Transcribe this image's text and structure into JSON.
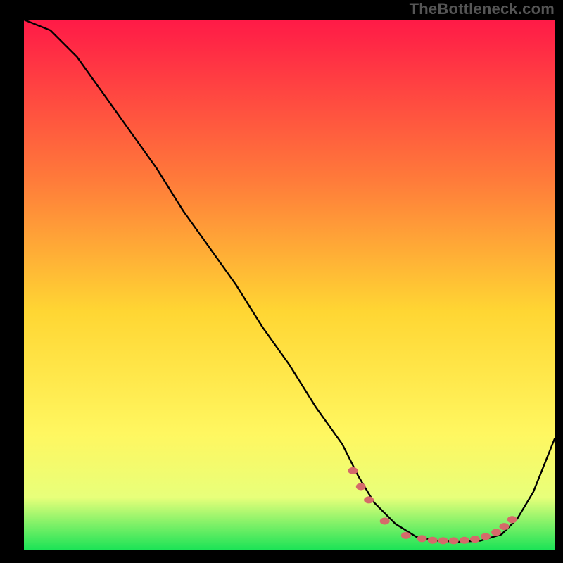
{
  "watermark": "TheBottleneck.com",
  "chart_frame": {
    "x0": 34,
    "y0": 28,
    "x1": 788,
    "y1": 782
  },
  "chart_data": {
    "type": "line",
    "title": "",
    "xlabel": "",
    "ylabel": "",
    "xlim": [
      0,
      100
    ],
    "ylim": [
      0,
      100
    ],
    "gradient_colors": {
      "top": "#ff1a47",
      "mid_upper": "#ff7a3a",
      "mid": "#ffd633",
      "mid_lower": "#fff760",
      "low": "#e8ff7a",
      "bottom": "#19e356"
    },
    "series": [
      {
        "name": "bottleneck-curve",
        "x": [
          0,
          5,
          10,
          15,
          20,
          25,
          30,
          35,
          40,
          45,
          50,
          55,
          60,
          63,
          66,
          70,
          74,
          78,
          82,
          86,
          90,
          93,
          96,
          100
        ],
        "y": [
          100,
          98,
          93,
          86,
          79,
          72,
          64,
          57,
          50,
          42,
          35,
          27,
          20,
          14,
          9,
          5,
          2.5,
          1.8,
          1.6,
          1.8,
          3,
          6,
          11,
          21
        ]
      }
    ],
    "markers": [
      {
        "name": "dotted-region",
        "color": "#d56a6a",
        "points": [
          {
            "x": 62,
            "y": 15
          },
          {
            "x": 63.5,
            "y": 12
          },
          {
            "x": 65,
            "y": 9.5
          },
          {
            "x": 68,
            "y": 5.5
          },
          {
            "x": 72,
            "y": 2.8
          },
          {
            "x": 75,
            "y": 2.2
          },
          {
            "x": 77,
            "y": 1.9
          },
          {
            "x": 79,
            "y": 1.8
          },
          {
            "x": 81,
            "y": 1.8
          },
          {
            "x": 83,
            "y": 1.9
          },
          {
            "x": 85,
            "y": 2.1
          },
          {
            "x": 87,
            "y": 2.6
          },
          {
            "x": 89,
            "y": 3.4
          },
          {
            "x": 90.5,
            "y": 4.5
          },
          {
            "x": 92,
            "y": 5.8
          }
        ]
      }
    ]
  }
}
